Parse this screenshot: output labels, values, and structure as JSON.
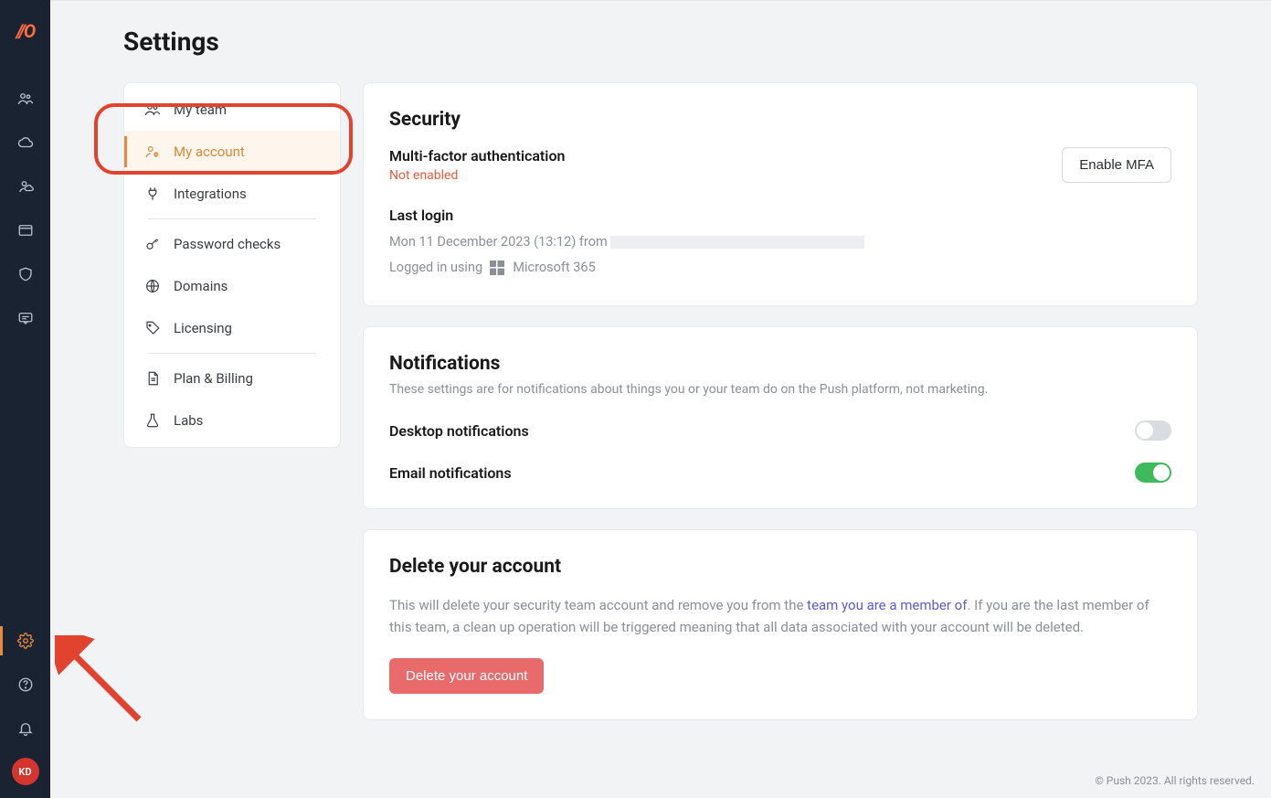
{
  "logo_text": "//O",
  "avatar_initials": "KD",
  "page_title": "Settings",
  "settings_nav": {
    "items": [
      {
        "label": "My team"
      },
      {
        "label": "My account"
      },
      {
        "label": "Integrations"
      },
      {
        "label": "Password checks"
      },
      {
        "label": "Domains"
      },
      {
        "label": "Licensing"
      },
      {
        "label": "Plan & Billing"
      },
      {
        "label": "Labs"
      }
    ]
  },
  "security": {
    "heading": "Security",
    "mfa_label": "Multi-factor authentication",
    "mfa_status": "Not enabled",
    "mfa_button": "Enable MFA",
    "last_login_label": "Last login",
    "last_login_time": "Mon 11 December 2023 (13:12) from ",
    "login_method_prefix": "Logged in using",
    "login_method_name": "Microsoft 365"
  },
  "notifications": {
    "heading": "Notifications",
    "subtext": "These settings are for notifications about things you or your team do on the Push platform, not marketing.",
    "desktop_label": "Desktop notifications",
    "desktop_on": false,
    "email_label": "Email notifications",
    "email_on": true
  },
  "delete": {
    "heading": "Delete your account",
    "text_before": "This will delete your security team account and remove you from the ",
    "link_text": "team you are a member of",
    "text_after": ". If you are the last member of this team, a clean up operation will be triggered meaning that all data associated with your account will be deleted.",
    "button": "Delete your account"
  },
  "footer": "© Push 2023. All rights reserved."
}
